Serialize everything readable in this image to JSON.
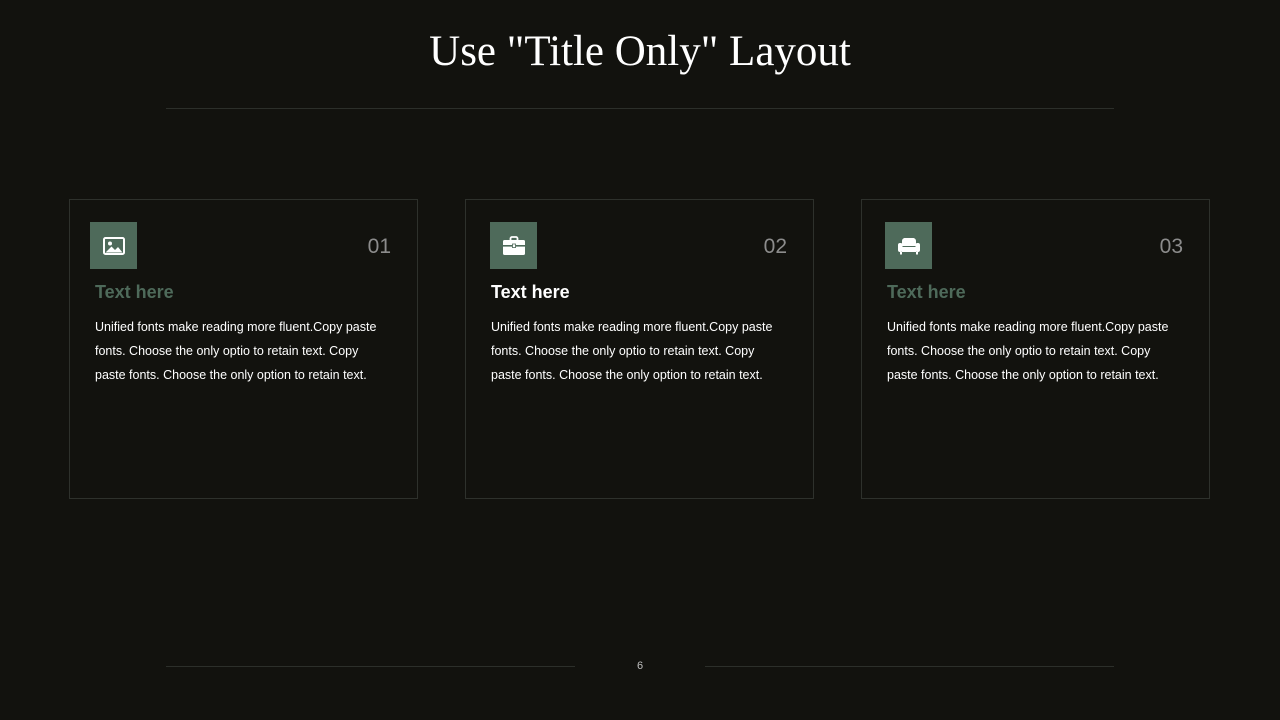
{
  "slide": {
    "title": "Use \"Title Only\" Layout",
    "page_number": "6"
  },
  "colors": {
    "background": "#12120e",
    "accent": "#4e6a5a",
    "rule": "#2c2f2a",
    "card_border": "#2e312c",
    "number_gray": "#8c8c8c"
  },
  "cards": [
    {
      "icon": "image-icon",
      "number": "01",
      "heading": "Text here",
      "heading_color": "#4e6a5a",
      "body": "Unified fonts make reading more fluent.Copy paste fonts. Choose the only optio to retain text. Copy paste fonts. Choose the only option to retain text."
    },
    {
      "icon": "briefcase-icon",
      "number": "02",
      "heading": "Text here",
      "heading_color": "#ffffff",
      "body": "Unified fonts make reading more fluent.Copy paste fonts. Choose the only optio to retain text. Copy paste fonts. Choose the only option to retain text."
    },
    {
      "icon": "armchair-icon",
      "number": "03",
      "heading": "Text here",
      "heading_color": "#4e6a5a",
      "body": "Unified fonts make reading more fluent.Copy paste fonts. Choose the only optio to retain text. Copy paste fonts. Choose the only option to retain text."
    }
  ]
}
